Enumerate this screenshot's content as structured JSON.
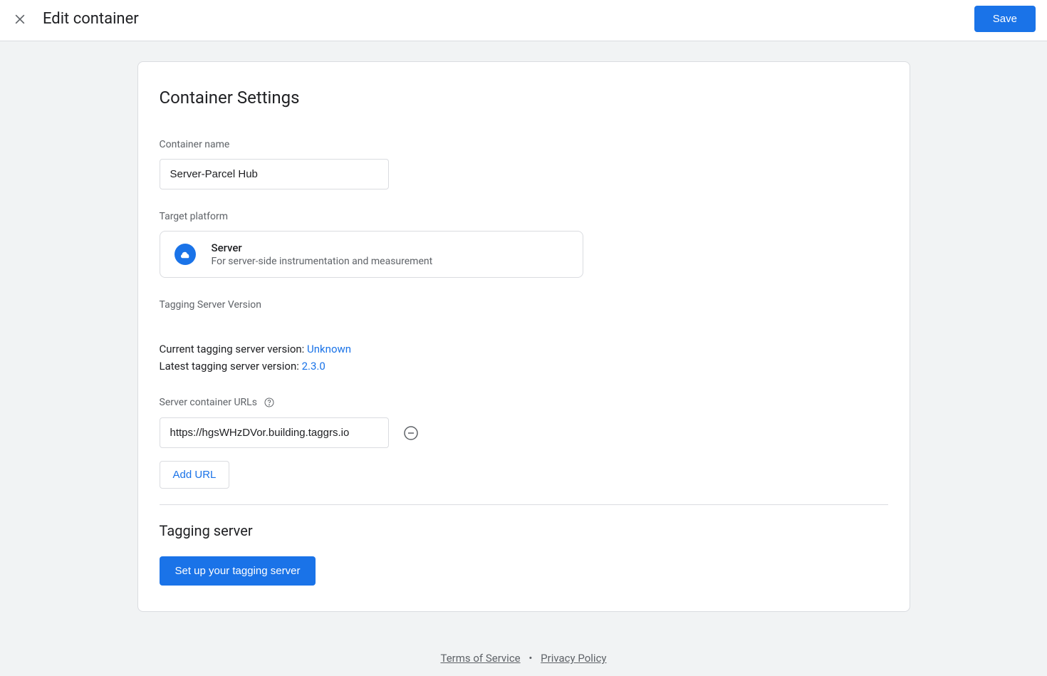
{
  "header": {
    "title": "Edit container",
    "save_label": "Save"
  },
  "settings": {
    "heading": "Container Settings",
    "container_name_label": "Container name",
    "container_name_value": "Server-Parcel Hub",
    "target_platform_label": "Target platform",
    "platform": {
      "name": "Server",
      "description": "For server-side instrumentation and measurement"
    },
    "tagging_version_label": "Tagging Server Version",
    "current_version_text": "Current tagging server version: ",
    "current_version_value": "Unknown",
    "latest_version_text": "Latest tagging server version: ",
    "latest_version_value": "2.3.0",
    "server_urls_label": "Server container URLs",
    "url_value": "https://hgsWHzDVor.building.taggrs.io",
    "add_url_label": "Add URL",
    "tagging_server_heading": "Tagging server",
    "setup_button_label": "Set up your tagging server"
  },
  "footer": {
    "terms": "Terms of Service",
    "privacy": "Privacy Policy"
  }
}
